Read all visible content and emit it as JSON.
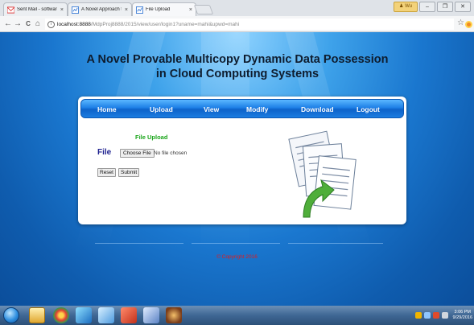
{
  "browser": {
    "tabs": [
      {
        "title": "Sent Mail - softwarepro",
        "close": "×"
      },
      {
        "title": "A Novel Approach to Pr",
        "close": "×"
      },
      {
        "title": "File Upload",
        "close": "×"
      }
    ],
    "window_controls": {
      "user": "♟ Wu",
      "minimize": "–",
      "maximize": "❐",
      "close": "✕"
    },
    "nav": {
      "back": "←",
      "forward": "→",
      "reload": "C",
      "home": "⌂",
      "info": "i",
      "star": "☆"
    },
    "url": {
      "host": "localhost:8888",
      "path": "/MdpProj8888/2015/view/user/login1?uname=mahi&upwd=mahi"
    }
  },
  "page": {
    "title_line1": "A Novel Provable Multicopy Dynamic Data Possession",
    "title_line2": "in Cloud Computing Systems",
    "nav": [
      {
        "label": "Home"
      },
      {
        "label": "Upload"
      },
      {
        "label": "View"
      },
      {
        "label": "Modify"
      },
      {
        "label": "Download"
      },
      {
        "label": "Logout"
      }
    ],
    "upload": {
      "heading": "File Upload",
      "file_label": "File",
      "choose_file": "Choose File",
      "no_file": "No file chosen",
      "reset": "Reset",
      "submit": "Submit"
    },
    "copyright": "© Copyright 2016"
  },
  "taskbar": {
    "clock_time": "3:06 PM",
    "clock_date": "9/29/2016"
  },
  "colors": {
    "nav_bar": "#1d7fe6",
    "heading_green": "#1aa51a",
    "file_label_blue": "#1c1f8e",
    "copyright_red": "#e21b1b"
  }
}
